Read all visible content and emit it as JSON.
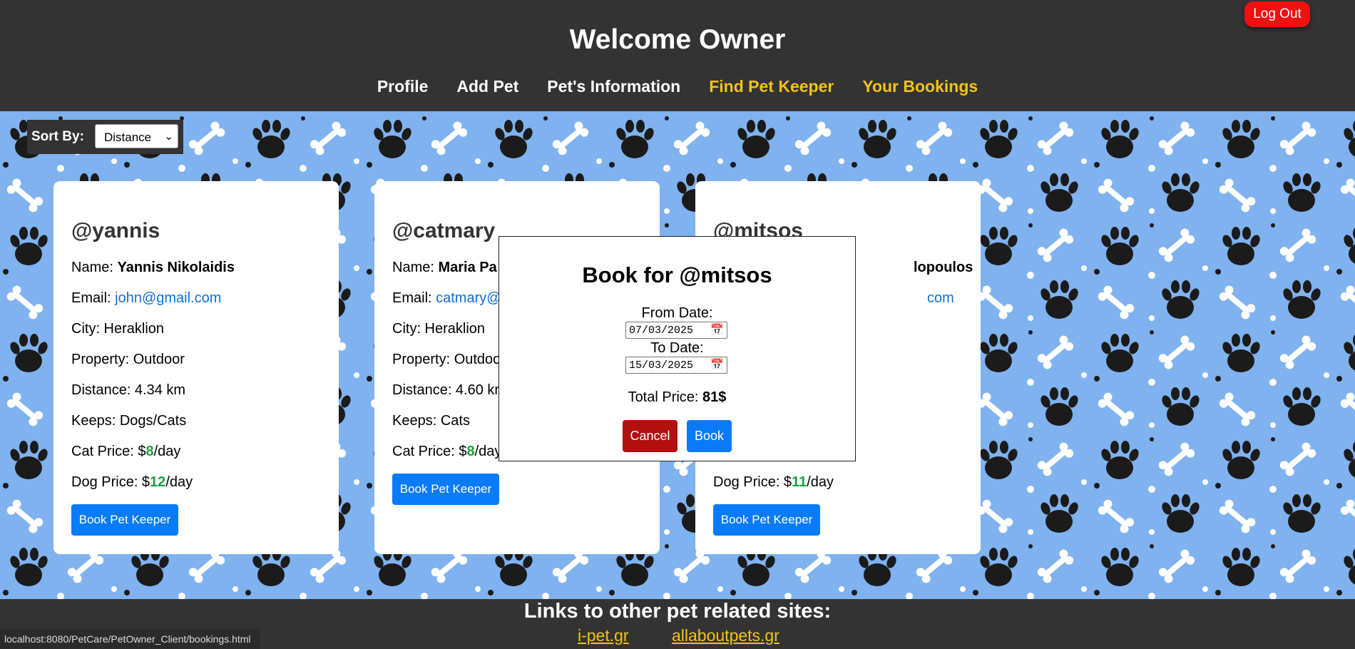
{
  "header": {
    "title": "Welcome Owner",
    "logout_label": "Log Out",
    "nav": [
      {
        "label": "Profile"
      },
      {
        "label": "Add Pet"
      },
      {
        "label": "Pet's Information"
      },
      {
        "label": "Find Pet Keeper"
      },
      {
        "label": "Your Bookings"
      }
    ]
  },
  "sort": {
    "label": "Sort By:",
    "selected": "Distance"
  },
  "cards": [
    {
      "handle": "@yannis",
      "name_label": "Name: ",
      "name": "Yannis Nikolaidis",
      "email_label": "Email: ",
      "email": "john@gmail.com",
      "city": "City: Heraklion",
      "property": "Property: Outdoor",
      "distance": "Distance: 4.34 km",
      "keeps": "Keeps: Dogs/Cats",
      "cat_price_prefix": "Cat Price: $",
      "cat_price": "8",
      "cat_price_suffix": "/day",
      "dog_price_prefix": "Dog Price: $",
      "dog_price": "12",
      "dog_price_suffix": "/day",
      "button": "Book Pet Keeper"
    },
    {
      "handle": "@catmary",
      "name_label": "Name: ",
      "name": "Maria Pa",
      "email_label": "Email: ",
      "email": "catmary@",
      "city": "City: Heraklion",
      "property": "Property: Outdoo",
      "distance": "Distance: 4.60 kr",
      "keeps": "Keeps: Cats",
      "cat_price_prefix": "Cat Price: $",
      "cat_price": "8",
      "cat_price_suffix": "/day",
      "button": "Book Pet Keeper"
    },
    {
      "handle": "@mitsos",
      "name_tail": "lopoulos",
      "email_tail": "com",
      "dog_price_prefix": "Dog Price: $",
      "dog_price": "11",
      "dog_price_suffix": "/day",
      "button": "Book Pet Keeper"
    }
  ],
  "modal": {
    "title": "Book for @mitsos",
    "from_label": "From Date:",
    "from_value": "07/03/2025",
    "to_label": "To Date:",
    "to_value": "15/03/2025",
    "total_label": "Total Price: ",
    "total_value": "81$",
    "cancel_label": "Cancel",
    "book_label": "Book"
  },
  "footer": {
    "title": "Links to other pet related sites:",
    "links": [
      {
        "label": "i-pet.gr"
      },
      {
        "label": "allaboutpets.gr"
      }
    ]
  },
  "status_url": "localhost:8080/PetCare/PetOwner_Client/bookings.html",
  "colors": {
    "header_bg": "#333333",
    "pattern_bg": "#7fb2ef",
    "accent_nav": "#f2c413",
    "primary_button": "#0a7bf8",
    "logout_button": "#f01010",
    "cancel_button": "#b30f0f",
    "price_green": "#1f9e3e"
  },
  "icons": {
    "background": "paw-and-bone-pattern",
    "select": "chevron-down-icon",
    "date": "calendar-icon"
  }
}
